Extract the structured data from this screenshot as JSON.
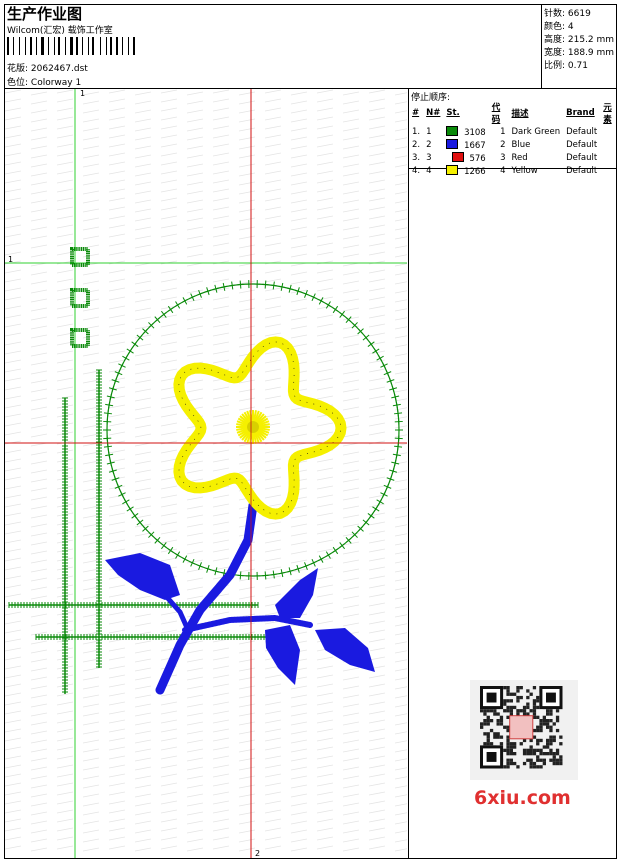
{
  "header": {
    "title": "生产作业图",
    "company": "Wilcom(汇宏) 载饰工作室",
    "design_label": "花版:",
    "design_value": "2062467.dst",
    "colorway_label": "色位:",
    "colorway_value": "Colorway 1"
  },
  "stats": {
    "stitches": "针数: 6619",
    "colors": "颜色: 4",
    "height": "高度: 215.2 mm",
    "width": "宽度: 188.9 mm",
    "scale": "比例: 0.71"
  },
  "sequence": {
    "title": "停止顺序:",
    "headers": [
      "#",
      "N#",
      "St.",
      "代码",
      "描述",
      "Brand",
      "元素"
    ],
    "rows": [
      {
        "idx": "1.",
        "n": "1",
        "color": "#0a8a0a",
        "st": "3108",
        "code": "1",
        "desc": "Dark Green",
        "brand": "Default"
      },
      {
        "idx": "2.",
        "n": "2",
        "color": "#1a1ae0",
        "st": "1667",
        "code": "2",
        "desc": "Blue",
        "brand": "Default"
      },
      {
        "idx": "3.",
        "n": "3",
        "color": "#e01010",
        "st": "576",
        "code": "3",
        "desc": "Red",
        "brand": "Default"
      },
      {
        "idx": "4.",
        "n": "4",
        "color": "#f5f000",
        "st": "1266",
        "code": "4",
        "desc": "Yellow",
        "brand": "Default"
      }
    ]
  },
  "canvas": {
    "guide_labels": {
      "top": "1",
      "left": "1",
      "bottom": "2"
    },
    "colors": {
      "green": "#0a8a0a",
      "blue": "#1a1ae0",
      "red": "#d01010",
      "yellow": "#f5f000",
      "guide_green": "#30d030"
    }
  },
  "watermark": "6xiu.com"
}
